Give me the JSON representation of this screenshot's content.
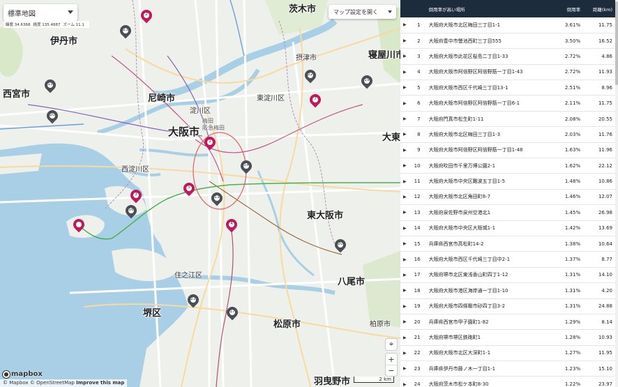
{
  "map": {
    "style_select": "標準地図",
    "coords": {
      "lat": "緯度 34.6368",
      "lon": "経度 135.4887",
      "zoom": "ズーム 11.1"
    },
    "settings_button": "マップ設定を開く",
    "controls": {
      "locate": "⌖",
      "zoom_in": "+",
      "zoom_out": "−"
    },
    "logo": "mapbox",
    "attribution": {
      "mapbox": "© Mapbox",
      "osm": "© OpenStreetMap",
      "improve": "Improve this map"
    },
    "scale": "2 km",
    "labels": {
      "itami": "伊丹市",
      "ibaraki": "茨木市",
      "settsu": "摂津市",
      "neyagawa": "寝屋川市",
      "nishinomiya": "西宮市",
      "amagasaki": "尼崎市",
      "yodogawa": "淀川区",
      "higashiyodogawa": "東淀川区",
      "osaka": "大阪市",
      "nishiyodogawa": "西淀川区",
      "higashiosaka": "東大阪市",
      "suminoe": "住之江区",
      "sakai": "堺区",
      "matsubara": "松原市",
      "yao": "八尾市",
      "kashiwara": "柏原市",
      "habikino": "羽曳野市",
      "daito": "大東市",
      "umeda": "梅田",
      "hankyu": "阪急梅田"
    },
    "pins": [
      {
        "n": "2",
        "color": "red"
      },
      {
        "n": "23",
        "color": "grey"
      },
      {
        "n": "15",
        "color": "grey"
      },
      {
        "n": "20",
        "color": "grey"
      },
      {
        "n": "22",
        "color": "grey"
      },
      {
        "n": "19",
        "color": "grey"
      },
      {
        "n": "7",
        "color": "red"
      },
      {
        "n": "1",
        "color": "red"
      },
      {
        "n": "14",
        "color": "grey"
      },
      {
        "n": "3",
        "color": "red"
      },
      {
        "n": "5",
        "color": "red"
      },
      {
        "n": "16",
        "color": "grey"
      },
      {
        "n": "11",
        "color": "grey"
      },
      {
        "n": "4",
        "color": "red"
      },
      {
        "n": "",
        "color": "red"
      },
      {
        "n": "18",
        "color": "grey"
      },
      {
        "n": "20",
        "color": "grey"
      },
      {
        "n": "21",
        "color": "grey"
      },
      {
        "n": "17",
        "color": "grey"
      }
    ]
  },
  "table": {
    "headers": {
      "place": "倒用率が高い場所",
      "rate": "倒用率",
      "dist": "距離(km)"
    },
    "rows": [
      {
        "idx": "1",
        "place": "大阪府大阪市北区梅田三丁目1-1",
        "rate": "3.61%",
        "dist": "11.75"
      },
      {
        "idx": "2",
        "place": "大阪府豊中市螢池西町三丁目555",
        "rate": "3.50%",
        "dist": "16.52"
      },
      {
        "idx": "3",
        "place": "大阪府大阪市此花区桜島二丁目1-33",
        "rate": "2.72%",
        "dist": "4.86"
      },
      {
        "idx": "4",
        "place": "大阪府大阪市阿倍野区阿倍野筋一丁目1-43",
        "rate": "2.72%",
        "dist": "11.93"
      },
      {
        "idx": "5",
        "place": "大阪府大阪市西区千代崎三丁目13-1",
        "rate": "2.51%",
        "dist": "8.96"
      },
      {
        "idx": "6",
        "place": "大阪府大阪市阿倍野区阿倍野筋一丁目6-1",
        "rate": "2.11%",
        "dist": "11.75"
      },
      {
        "idx": "7",
        "place": "大阪府門真市松生町1-11",
        "rate": "2.08%",
        "dist": "20.55"
      },
      {
        "idx": "8",
        "place": "大阪府大阪市北区梅田三丁目1-3",
        "rate": "2.03%",
        "dist": "11.76"
      },
      {
        "idx": "9",
        "place": "大阪府大阪市阿倍野区阿倍野筋一丁目1-48",
        "rate": "1.63%",
        "dist": "11.96"
      },
      {
        "idx": "10",
        "place": "大阪府吹田市千里万博公園2-1",
        "rate": "1.62%",
        "dist": "22.12"
      },
      {
        "idx": "11",
        "place": "大阪府大阪市中央区難波五丁目1-5",
        "rate": "1.48%",
        "dist": "10.86"
      },
      {
        "idx": "12",
        "place": "大阪府大阪市北区角田町8-7",
        "rate": "1.46%",
        "dist": "12.07"
      },
      {
        "idx": "13",
        "place": "大阪府泉佐野市泉州空港北1",
        "rate": "1.45%",
        "dist": "26.98"
      },
      {
        "idx": "14",
        "place": "大阪府大阪市中央区大阪城1-1",
        "rate": "1.42%",
        "dist": "13.69"
      },
      {
        "idx": "15",
        "place": "兵庫県西宮市高松町14-2",
        "rate": "1.38%",
        "dist": "10.64"
      },
      {
        "idx": "16",
        "place": "大阪府大阪市西区千代崎三丁目中2-1",
        "rate": "1.37%",
        "dist": "8.77"
      },
      {
        "idx": "17",
        "place": "大阪府堺市北区東浅香山町四丁1-12",
        "rate": "1.31%",
        "dist": "14.10"
      },
      {
        "idx": "18",
        "place": "大阪府大阪市港区海岸通一丁目1-10",
        "rate": "1.31%",
        "dist": "4.20"
      },
      {
        "idx": "19",
        "place": "大阪府大阪市四條畷市砂四丁目3-2",
        "rate": "1.31%",
        "dist": "24.88"
      },
      {
        "idx": "20",
        "place": "兵庫県西宮市甲子園町1-82",
        "rate": "1.29%",
        "dist": "8.14"
      },
      {
        "idx": "21",
        "place": "大阪府堺市堺区鉄砲町1",
        "rate": "1.28%",
        "dist": "10.93"
      },
      {
        "idx": "22",
        "place": "大阪府大阪市北区大深町1-1",
        "rate": "1.27%",
        "dist": "11.95"
      },
      {
        "idx": "23",
        "place": "兵庫県伊丹市藤ノ木一丁目1-1",
        "rate": "1.23%",
        "dist": "15.10"
      },
      {
        "idx": "24",
        "place": "大阪府茨木市松ケ本町8-30",
        "rate": "1.22%",
        "dist": "23.97"
      }
    ]
  }
}
